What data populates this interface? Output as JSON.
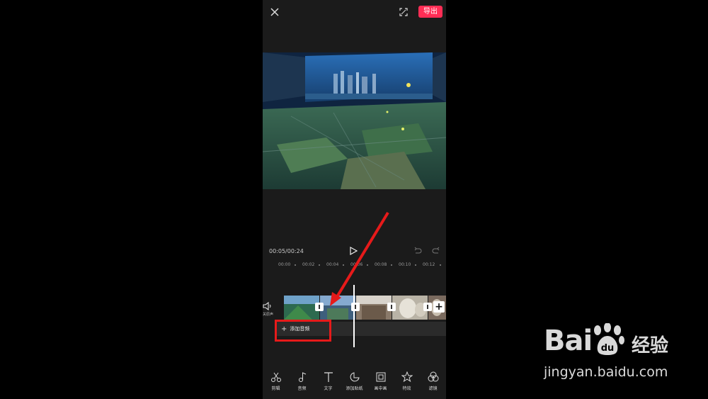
{
  "topbar": {
    "export_label": "导出"
  },
  "player": {
    "time": "00:05/00:24"
  },
  "ruler": {
    "ticks": [
      "00:00",
      "00:02",
      "00:04",
      "00:06",
      "00:08",
      "00:10",
      "00:12"
    ]
  },
  "track": {
    "mute_label": "关原声"
  },
  "audio": {
    "add_audio_label": "添加音频"
  },
  "toolbar": {
    "items": [
      {
        "label": "剪辑",
        "icon": "scissors-icon"
      },
      {
        "label": "音频",
        "icon": "music-note-icon"
      },
      {
        "label": "文字",
        "icon": "text-icon"
      },
      {
        "label": "添加贴纸",
        "icon": "sticker-icon"
      },
      {
        "label": "画中画",
        "icon": "picture-in-picture-icon"
      },
      {
        "label": "特效",
        "icon": "effects-star-icon"
      },
      {
        "label": "滤镜",
        "icon": "filter-icon"
      }
    ]
  },
  "watermark": {
    "brand": "Bai",
    "brand_cn": "经验",
    "url": "jingyan.baidu.com"
  },
  "colors": {
    "accent": "#ff2d55",
    "highlight": "#e61a1a",
    "background": "#1b1b1b"
  }
}
